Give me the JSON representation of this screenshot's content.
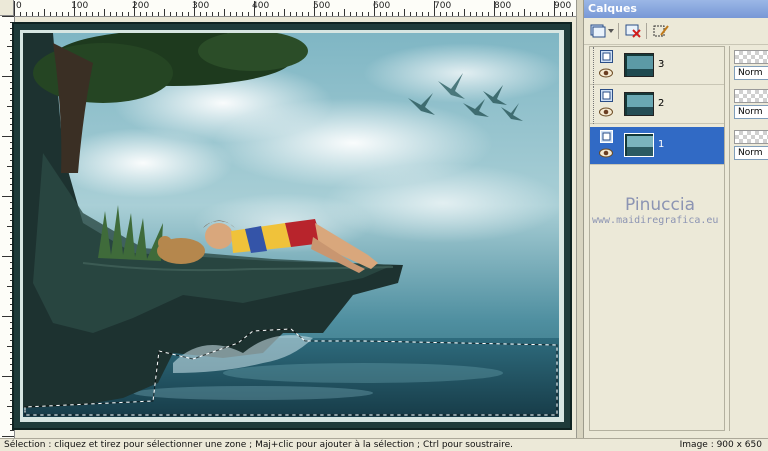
{
  "rulers": {
    "horizontal_labels": [
      "0",
      "100",
      "200",
      "300",
      "400",
      "500",
      "600",
      "700",
      "800",
      "900"
    ]
  },
  "layers_panel": {
    "title": "Calques",
    "layers": [
      {
        "name": "3",
        "visible": true,
        "selected": false
      },
      {
        "name": "2",
        "visible": true,
        "selected": false
      },
      {
        "name": "1",
        "visible": true,
        "selected": true
      }
    ],
    "blend_modes": [
      "Norm",
      "Norm",
      "Norm"
    ]
  },
  "watermark": {
    "name": "Pinuccia",
    "site": "www.maidiregrafica.eu"
  },
  "status": {
    "left": "Sélection : cliquez et tirez pour sélectionner une zone ; Maj+clic pour ajouter à la sélection ; Ctrl pour soustraire.",
    "right": "Image : 900 x 650"
  },
  "colors": {
    "selection_blue": "#316ac5",
    "panel_title": "#7898d6",
    "frame_dark": "#1e3b3a"
  }
}
